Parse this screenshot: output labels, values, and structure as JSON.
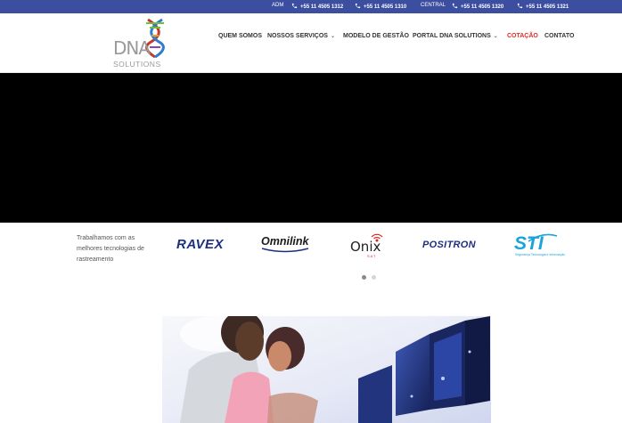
{
  "topbar": {
    "adm_label": "ADM",
    "adm_phone": "+55 11 4505 1312",
    "phone2": "+55 11 4505 1310",
    "central_label": "CENTRAL",
    "central_phone": "+55 11 4505 1320",
    "phone4": "+55 11 4505 1321",
    "background_color": "#3c4ea0"
  },
  "logo": {
    "text": "DNA",
    "subtext": "SOLUTIONS"
  },
  "nav": {
    "items": [
      {
        "label": "QUEM SOMOS"
      },
      {
        "label": "NOSSOS SERVIÇOS",
        "has_dropdown": true
      },
      {
        "label": "MODELO DE GESTÃO"
      },
      {
        "label": "PORTAL DNA SOLUTIONS",
        "has_dropdown": true
      },
      {
        "label": "COTAÇÃO",
        "active": true
      },
      {
        "label": "CONTATO"
      }
    ],
    "active_color": "#e02b2b"
  },
  "hero": {
    "background_color": "#000000"
  },
  "partners": {
    "text": "Trabalhamos com as melhores tecnologias de rastreamento",
    "brands": [
      {
        "name": "RAVEX"
      },
      {
        "name": "Omnilink"
      },
      {
        "name": "Onix",
        "sub": "SAT"
      },
      {
        "name": "POSITRON"
      },
      {
        "name": "STI",
        "sub": "Segurança Tecnologia e Informação"
      }
    ],
    "slider_current": 1,
    "slider_total": 2
  },
  "icons": {
    "phone": "phone-icon",
    "chevron": "chevron-down-icon"
  }
}
